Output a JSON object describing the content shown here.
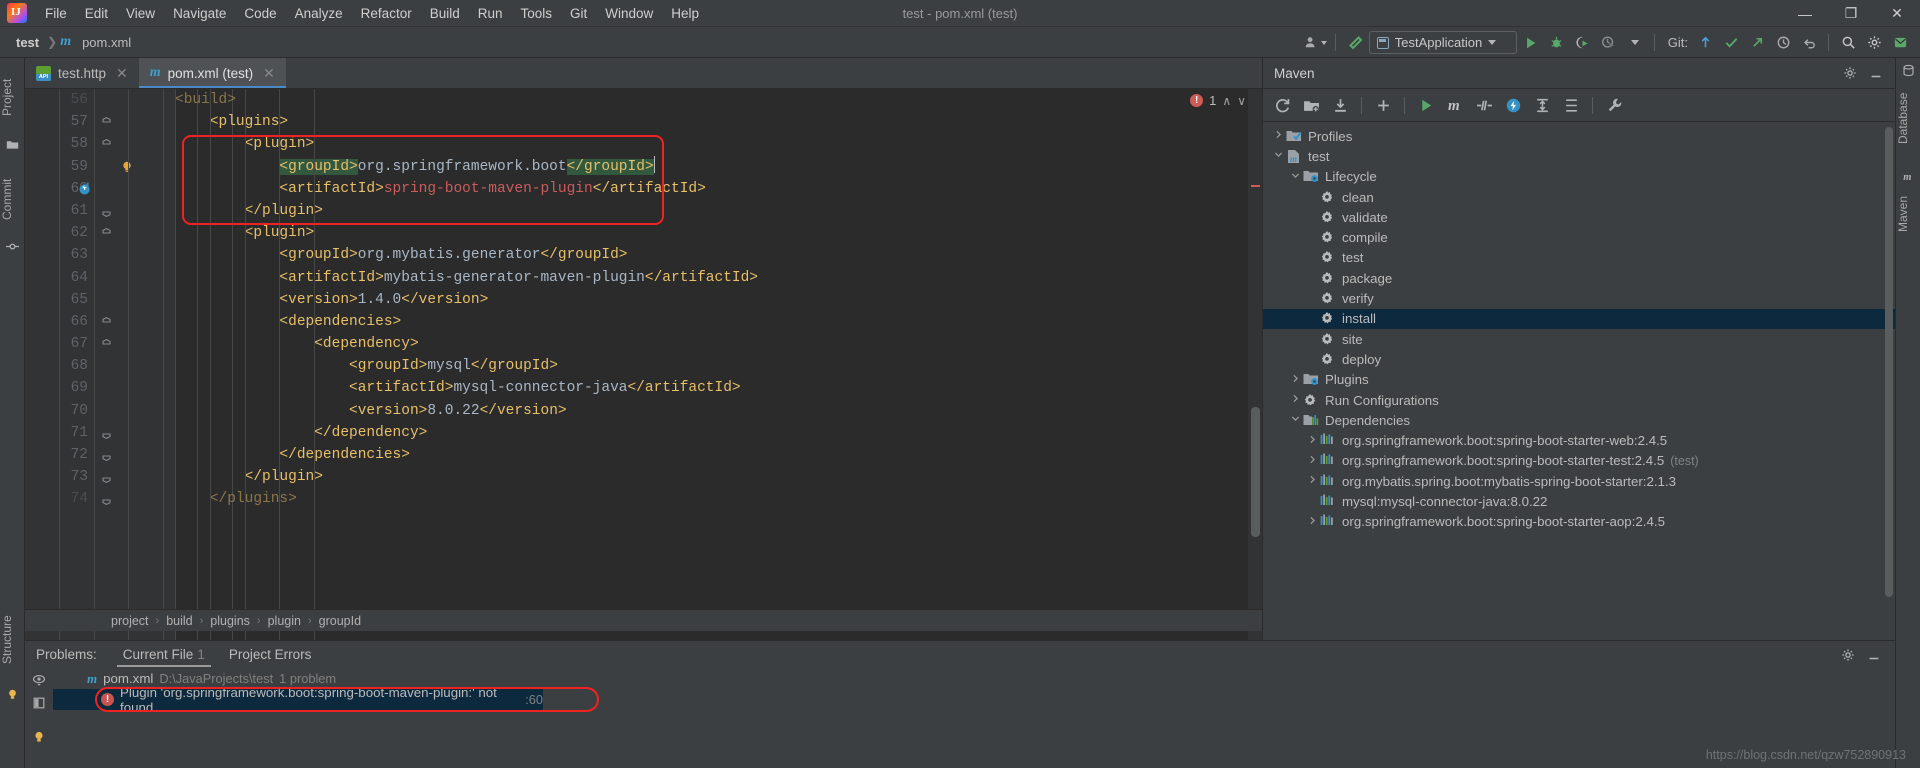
{
  "window": {
    "title": "test - pom.xml (test)"
  },
  "menu": {
    "items": [
      "File",
      "Edit",
      "View",
      "Navigate",
      "Code",
      "Analyze",
      "Refactor",
      "Build",
      "Run",
      "Tools",
      "Git",
      "Window",
      "Help"
    ]
  },
  "window_controls": {
    "minimize": "—",
    "maximize": "❐",
    "close": "✕"
  },
  "navbar": {
    "crumbs": [
      "test",
      "pom.xml"
    ],
    "file_icon": "maven-m-icon"
  },
  "toolbar": {
    "profile_icon": "user-profile-icon",
    "build_icon": "build-hammer-icon",
    "run_config": "TestApplication",
    "run_icon": "run-icon",
    "debug_icon": "debug-icon",
    "run_coverage_icon": "run-with-coverage-icon",
    "profiler_icon": "profiler-icon",
    "git_label": "Git:",
    "update_icon": "git-update-icon",
    "commit_icon": "git-commit-icon",
    "push_icon": "git-push-icon",
    "history_icon": "history-icon",
    "undo_icon": "undo-icon",
    "search_icon": "search-icon",
    "settings_icon": "gear-icon",
    "notifications_icon": "notifications-icon"
  },
  "left_strip": {
    "items": [
      "Project",
      "Commit"
    ]
  },
  "right_strip": {
    "items": [
      "Database",
      "Maven"
    ]
  },
  "editor": {
    "tabs": [
      {
        "label": "test.http",
        "icon": "http-file-icon",
        "active": false
      },
      {
        "label": "pom.xml (test)",
        "icon": "maven-m-icon",
        "active": true
      }
    ],
    "inspection": {
      "error_count": "1",
      "up": "∧",
      "down": "∨"
    },
    "first_line_number": 56,
    "lines": [
      {
        "n": 56,
        "indent": 4,
        "fold": "none",
        "partial": true,
        "tokens": [
          {
            "t": "<build>",
            "c": "tag"
          }
        ]
      },
      {
        "n": 57,
        "indent": 4,
        "fold": "collapse",
        "tokens": [
          {
            "t": "    <plugins>",
            "c": "tag"
          }
        ]
      },
      {
        "n": 58,
        "indent": 6,
        "fold": "collapse",
        "tokens": [
          {
            "t": "        <plugin>",
            "c": "tag"
          }
        ]
      },
      {
        "n": 59,
        "indent": 8,
        "fold": "none",
        "bulb": true,
        "tokens": [
          {
            "t": "            ",
            "c": "plain"
          },
          {
            "t": "<groupId>",
            "c": "tag",
            "sel": true
          },
          {
            "t": "org.springframework.boot",
            "c": "val"
          },
          {
            "t": "</groupId>",
            "c": "tag",
            "sel": true
          }
        ],
        "caret_after": true
      },
      {
        "n": 60,
        "indent": 8,
        "fold": "none",
        "vcs": true,
        "tokens": [
          {
            "t": "            ",
            "c": "plain"
          },
          {
            "t": "<artifactId>",
            "c": "tag"
          },
          {
            "t": "spring-boot-maven-plugin",
            "c": "red"
          },
          {
            "t": "</artifactId>",
            "c": "tag"
          }
        ]
      },
      {
        "n": 61,
        "indent": 6,
        "fold": "end",
        "tokens": [
          {
            "t": "        </plugin>",
            "c": "tag"
          }
        ]
      },
      {
        "n": 62,
        "indent": 6,
        "fold": "collapse",
        "tokens": [
          {
            "t": "        <plugin>",
            "c": "tag"
          }
        ]
      },
      {
        "n": 63,
        "indent": 8,
        "fold": "none",
        "tokens": [
          {
            "t": "            ",
            "c": "plain"
          },
          {
            "t": "<groupId>",
            "c": "tag"
          },
          {
            "t": "org.mybatis.generator",
            "c": "val"
          },
          {
            "t": "</groupId>",
            "c": "tag"
          }
        ]
      },
      {
        "n": 64,
        "indent": 8,
        "fold": "none",
        "tokens": [
          {
            "t": "            ",
            "c": "plain"
          },
          {
            "t": "<artifactId>",
            "c": "tag"
          },
          {
            "t": "mybatis-generator-maven-plugin",
            "c": "val"
          },
          {
            "t": "</artifactId>",
            "c": "tag"
          }
        ]
      },
      {
        "n": 65,
        "indent": 8,
        "fold": "none",
        "tokens": [
          {
            "t": "            ",
            "c": "plain"
          },
          {
            "t": "<version>",
            "c": "tag"
          },
          {
            "t": "1.4.0",
            "c": "val"
          },
          {
            "t": "</version>",
            "c": "tag"
          }
        ]
      },
      {
        "n": 66,
        "indent": 8,
        "fold": "collapse",
        "tokens": [
          {
            "t": "            <dependencies>",
            "c": "tag"
          }
        ]
      },
      {
        "n": 67,
        "indent": 10,
        "fold": "collapse",
        "tokens": [
          {
            "t": "                <dependency>",
            "c": "tag"
          }
        ]
      },
      {
        "n": 68,
        "indent": 12,
        "fold": "none",
        "tokens": [
          {
            "t": "                    ",
            "c": "plain"
          },
          {
            "t": "<groupId>",
            "c": "tag"
          },
          {
            "t": "mysql",
            "c": "val"
          },
          {
            "t": "</groupId>",
            "c": "tag"
          }
        ]
      },
      {
        "n": 69,
        "indent": 12,
        "fold": "none",
        "tokens": [
          {
            "t": "                    ",
            "c": "plain"
          },
          {
            "t": "<artifactId>",
            "c": "tag"
          },
          {
            "t": "mysql-connector-java",
            "c": "val"
          },
          {
            "t": "</artifactId>",
            "c": "tag"
          }
        ]
      },
      {
        "n": 70,
        "indent": 12,
        "fold": "none",
        "tokens": [
          {
            "t": "                    ",
            "c": "plain"
          },
          {
            "t": "<version>",
            "c": "tag"
          },
          {
            "t": "8.0.22",
            "c": "val"
          },
          {
            "t": "</version>",
            "c": "tag"
          }
        ]
      },
      {
        "n": 71,
        "indent": 10,
        "fold": "end",
        "tokens": [
          {
            "t": "                </dependency>",
            "c": "tag"
          }
        ]
      },
      {
        "n": 72,
        "indent": 8,
        "fold": "end",
        "tokens": [
          {
            "t": "            </dependencies>",
            "c": "tag"
          }
        ]
      },
      {
        "n": 73,
        "indent": 6,
        "fold": "end",
        "tokens": [
          {
            "t": "        </plugin>",
            "c": "tag"
          }
        ]
      },
      {
        "n": 74,
        "indent": 4,
        "fold": "end",
        "partial": true,
        "tokens": [
          {
            "t": "    </plugins>",
            "c": "tag"
          }
        ]
      }
    ],
    "breadcrumbs": [
      "project",
      "build",
      "plugins",
      "plugin",
      "groupId"
    ]
  },
  "maven": {
    "title": "Maven",
    "settings_icon": "gear-icon",
    "hide_icon": "hide-icon",
    "toolbar_icons": [
      "reload-icon",
      "add-maven-project-icon",
      "download-sources-icon",
      "add-icon",
      "run-icon",
      "execute-maven-goal-icon",
      "toggle-skip-tests-icon",
      "toggle-offline-icon",
      "expand-all-icon",
      "collapse-all-icon",
      "wrench-icon"
    ],
    "tree": [
      {
        "label": "Profiles",
        "depth": 0,
        "arrow": "collapsed",
        "icon": "profiles-folder-icon"
      },
      {
        "label": "test",
        "depth": 0,
        "arrow": "expanded",
        "icon": "maven-project-icon"
      },
      {
        "label": "Lifecycle",
        "depth": 1,
        "arrow": "expanded",
        "icon": "lifecycle-folder-icon"
      },
      {
        "label": "clean",
        "depth": 2,
        "arrow": "none",
        "icon": "goal-gear-icon"
      },
      {
        "label": "validate",
        "depth": 2,
        "arrow": "none",
        "icon": "goal-gear-icon"
      },
      {
        "label": "compile",
        "depth": 2,
        "arrow": "none",
        "icon": "goal-gear-icon"
      },
      {
        "label": "test",
        "depth": 2,
        "arrow": "none",
        "icon": "goal-gear-icon"
      },
      {
        "label": "package",
        "depth": 2,
        "arrow": "none",
        "icon": "goal-gear-icon"
      },
      {
        "label": "verify",
        "depth": 2,
        "arrow": "none",
        "icon": "goal-gear-icon"
      },
      {
        "label": "install",
        "depth": 2,
        "arrow": "none",
        "icon": "goal-gear-icon",
        "selected": true
      },
      {
        "label": "site",
        "depth": 2,
        "arrow": "none",
        "icon": "goal-gear-icon"
      },
      {
        "label": "deploy",
        "depth": 2,
        "arrow": "none",
        "icon": "goal-gear-icon"
      },
      {
        "label": "Plugins",
        "depth": 1,
        "arrow": "collapsed",
        "icon": "plugins-folder-icon"
      },
      {
        "label": "Run Configurations",
        "depth": 1,
        "arrow": "collapsed",
        "icon": "run-config-gear-icon"
      },
      {
        "label": "Dependencies",
        "depth": 1,
        "arrow": "expanded",
        "icon": "dependencies-icon"
      },
      {
        "label": "org.springframework.boot:spring-boot-starter-web:2.4.5",
        "depth": 2,
        "arrow": "collapsed",
        "icon": "library-icon"
      },
      {
        "label": "org.springframework.boot:spring-boot-starter-test:2.4.5",
        "depth": 2,
        "arrow": "collapsed",
        "icon": "library-icon",
        "scope": "(test)"
      },
      {
        "label": "org.mybatis.spring.boot:mybatis-spring-boot-starter:2.1.3",
        "depth": 2,
        "arrow": "collapsed",
        "icon": "library-icon"
      },
      {
        "label": "mysql:mysql-connector-java:8.0.22",
        "depth": 2,
        "arrow": "none",
        "icon": "library-icon"
      },
      {
        "label": "org.springframework.boot:spring-boot-starter-aop:2.4.5",
        "depth": 2,
        "arrow": "collapsed",
        "icon": "library-icon"
      }
    ]
  },
  "problems": {
    "label": "Problems:",
    "tabs": [
      {
        "label": "Current File",
        "count": "1",
        "active": true
      },
      {
        "label": "Project Errors",
        "count": "",
        "active": false
      }
    ],
    "settings_icon": "gear-icon",
    "hide_icon": "hide-icon",
    "side_icons": [
      "preview-eye-icon",
      "open-editor-preview-icon",
      "lightbulb-icon"
    ],
    "file_row": {
      "icon": "maven-m-icon",
      "name": "pom.xml",
      "path": "D:\\JavaProjects\\test",
      "count": "1 problem"
    },
    "items": [
      {
        "severity_icon": "error-icon",
        "message": "Plugin 'org.springframework.boot:spring-boot-maven-plugin:' not found",
        "line": ":60",
        "selected": true
      }
    ]
  },
  "watermark": "https://blog.csdn.net/qzw752890913",
  "colors": {
    "accent_blue": "#4a88c7",
    "error_red": "#c75450",
    "highlight_box": "#f02222",
    "selection_row": "#0d293e",
    "tag": "#e8bf6a",
    "value": "#a9b7c6"
  }
}
